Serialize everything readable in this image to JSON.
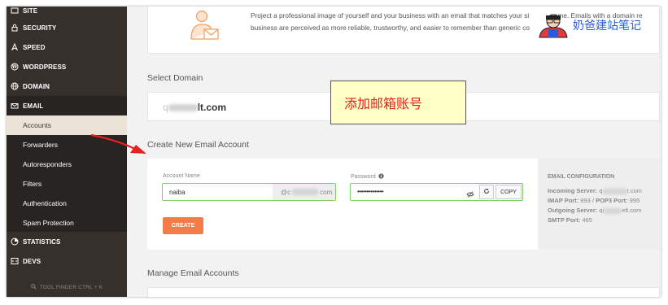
{
  "sidebar": {
    "items": [
      {
        "label": "SITE",
        "icon": "site-icon"
      },
      {
        "label": "SECURITY",
        "icon": "lock-icon"
      },
      {
        "label": "SPEED",
        "icon": "rocket-icon"
      },
      {
        "label": "WORDPRESS",
        "icon": "wordpress-icon"
      },
      {
        "label": "DOMAIN",
        "icon": "globe-icon"
      },
      {
        "label": "EMAIL",
        "icon": "envelope-icon"
      }
    ],
    "email_subitems": [
      "Accounts",
      "Forwarders",
      "Autoresponders",
      "Filters",
      "Authentication",
      "Spam Protection"
    ],
    "bottom_items": [
      {
        "label": "STATISTICS",
        "icon": "pie-chart-icon"
      },
      {
        "label": "DEVS",
        "icon": "code-icon"
      }
    ],
    "tool_finder": "TOOL FINDER CTRL + K"
  },
  "promo": {
    "line1": "Project a professional image of yourself and your business with an email that matches your si",
    "line1_tail": "name. Emails with a domain re",
    "line2": "business are perceived as more reliable, trustworthy, and easier to remember than generic co"
  },
  "select_domain": {
    "title": "Select Domain",
    "prefix": "q",
    "suffix": "lt.com"
  },
  "create_account": {
    "title": "Create New Email Account",
    "account_name_label": "Account Name",
    "account_name_value": "naiba",
    "account_suffix_start": "@c",
    "account_suffix_end": "com",
    "password_label": "Password",
    "password_value": "••••••••••••••",
    "copy_label": "COPY",
    "create_label": "CREATE"
  },
  "email_config": {
    "heading": "EMAIL CONFIGURATION",
    "incoming_label": "Incoming Server:",
    "incoming_value_start": "q",
    "incoming_value_end": "t.com",
    "imap_label": "IMAP Port:",
    "imap_value": "993",
    "pop3_label": "POP3 Port:",
    "pop3_value": "995",
    "outgoing_label": "Outgoing Server:",
    "outgoing_value_start": "qi",
    "outgoing_value_end": "elt.com",
    "smtp_label": "SMTP Port:",
    "smtp_value": "465"
  },
  "manage": {
    "title": "Manage Email Accounts"
  },
  "callout": {
    "text": "添加邮箱账号"
  },
  "watermark": {
    "text": "奶爸建站笔记"
  },
  "colors": {
    "sidebar_bg": "#35302c",
    "active_bg": "#ebe3d6",
    "accent_orange": "#f27c4a",
    "field_border": "#7fce6c",
    "annotation_red": "#e02020"
  }
}
